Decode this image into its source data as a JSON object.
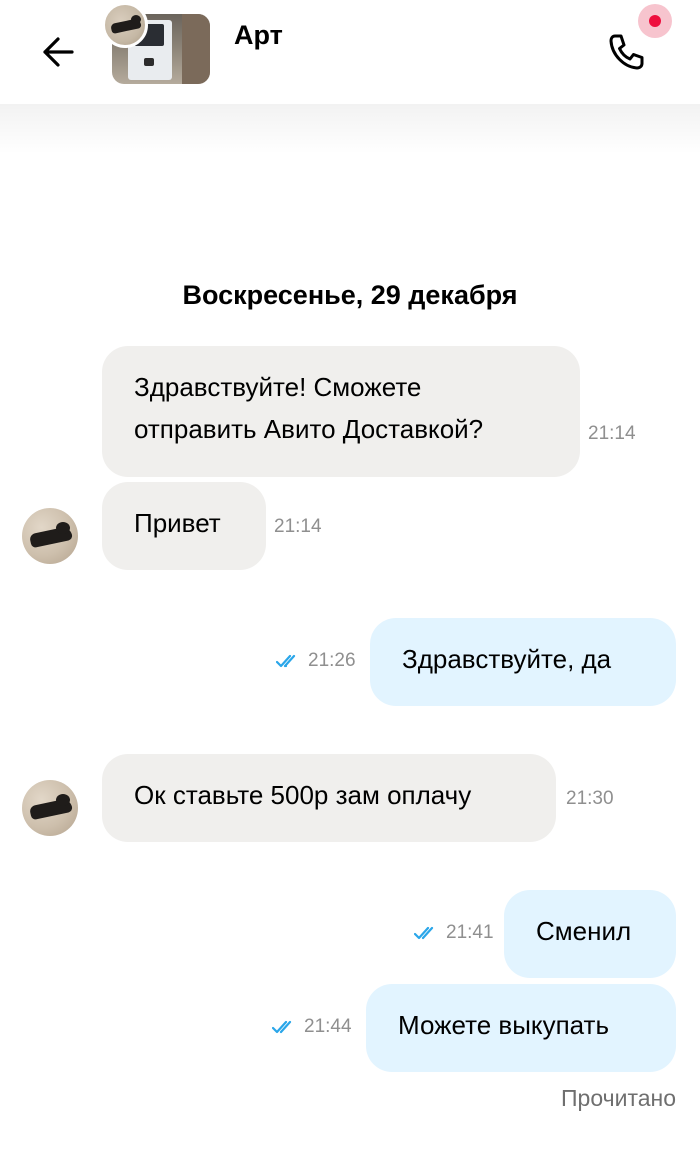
{
  "header": {
    "contact_name": "Арт",
    "back_icon": "arrow-left-icon",
    "call_icon": "phone-icon",
    "colors": {
      "call_badge": "#f7c4ce",
      "call_dot": "#ee0f3e"
    }
  },
  "chat": {
    "date_separator": "Воскресенье, 29 декабря",
    "messages": [
      {
        "direction": "incoming",
        "text": "Здравствуйте! Сможете отправить Авито Доставкой?",
        "time": "21:14"
      },
      {
        "direction": "incoming",
        "text": "Привет",
        "time": "21:14"
      },
      {
        "direction": "outgoing",
        "text": "Здравствуйте, да",
        "time": "21:26",
        "status": "read"
      },
      {
        "direction": "incoming",
        "text": "Ок ставьте 500р зам оплачу",
        "time": "21:30"
      },
      {
        "direction": "outgoing",
        "text": "Сменил",
        "time": "21:41",
        "status": "read"
      },
      {
        "direction": "outgoing",
        "text": "Можете выкупать",
        "time": "21:44",
        "status": "read"
      }
    ],
    "read_status": "Прочитано",
    "colors": {
      "incoming_bubble": "#f0efed",
      "outgoing_bubble": "#e2f4ff",
      "read_ticks": "#2aa6e9"
    }
  }
}
